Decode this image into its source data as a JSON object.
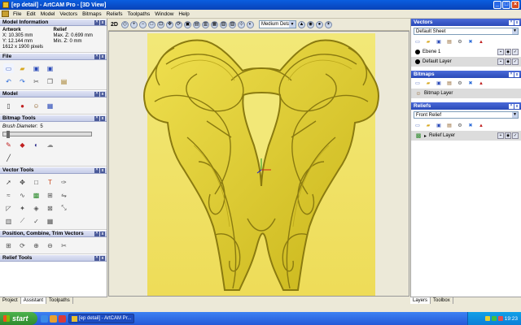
{
  "window": {
    "title": "[ep detail] - ArtCAM Pro - [3D View]"
  },
  "menu": [
    "File",
    "Edit",
    "Model",
    "Vectors",
    "Bitmaps",
    "Reliefs",
    "Toolpaths",
    "Window",
    "Help"
  ],
  "left": {
    "model_info": {
      "title": "Model Information",
      "artwork": "Artwork",
      "relief": "Relief",
      "x": "X: 10.305 mm",
      "y": "Y: 12.144 mm",
      "pixels": "1612 x 1900 pixels",
      "max_z": "Max. Z: 0.699 mm",
      "min_z": "Min. Z: 0 mm"
    },
    "file": {
      "title": "File"
    },
    "model": {
      "title": "Model"
    },
    "bitmap_tools": {
      "title": "Bitmap Tools",
      "brush_label": "Brush Diameter:",
      "brush_value": "5"
    },
    "vector_tools": {
      "title": "Vector Tools"
    },
    "pcv": {
      "title": "Position, Combine, Trim Vectors"
    },
    "relief_tools": {
      "title": "Relief Tools"
    },
    "tabs": [
      "Project",
      "Assistant",
      "Toolpaths"
    ]
  },
  "view": {
    "mode": "2D",
    "detail": "Medium Detail"
  },
  "right": {
    "vectors": {
      "title": "Vectors",
      "sheet": "Default Sheet",
      "layers": [
        "Ebene 1",
        "Default Layer"
      ]
    },
    "bitmaps": {
      "title": "Bitmaps",
      "layers": [
        "Bitmap Layer"
      ]
    },
    "reliefs": {
      "title": "Reliefs",
      "relief": "Front Relief",
      "layers": [
        "Relief Layer"
      ]
    },
    "tabs": [
      "Layers",
      "Toolbox"
    ]
  },
  "taskbar": {
    "start": "start",
    "task": "[ep detail] - ArtCAM Pr...",
    "time": "19:23"
  },
  "colors": {
    "relief": "#e0d030",
    "relief_shadow": "#8a7a10",
    "background": "#f0e86a",
    "accent": "#2a4ab8"
  }
}
